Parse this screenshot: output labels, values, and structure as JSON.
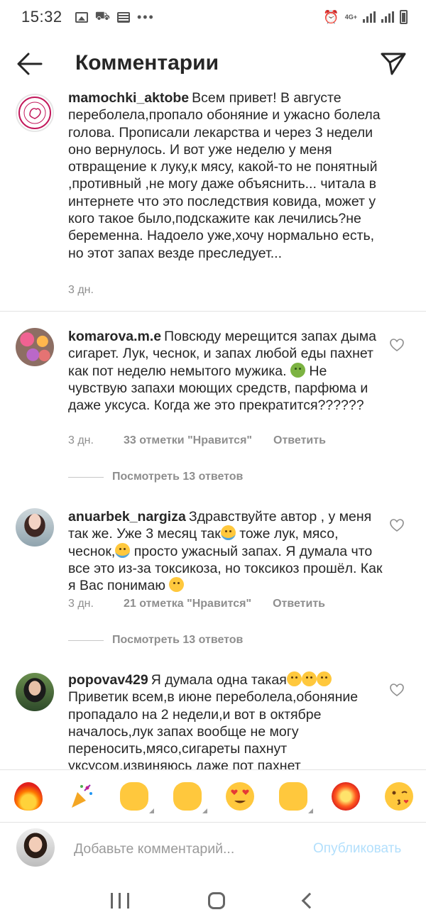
{
  "status_bar": {
    "time": "15:32",
    "network": "4G+",
    "left_icons": [
      "gallery-icon",
      "tractor-icon",
      "news-icon",
      "more-dots-icon"
    ],
    "right_icons": [
      "alarm-icon",
      "signal-icon",
      "signal-icon",
      "battery-icon"
    ]
  },
  "header": {
    "title": "Комментарии",
    "back_icon": "arrow-left-icon",
    "share_icon": "paper-plane-icon"
  },
  "comments": [
    {
      "username": "mamochki_aktobe",
      "text": "Всем привет! В августе переболела,пропало обоняние и ужасно болела голова. Прописали лекарства и через 3 недели оно вернулось. И вот уже неделю у меня отвращение к луку,к мясу, какой-то не понятный ,противный ,не могу даже объяснить... читала в интернете что это последствия ковида, может у кого такое было,подскажите как лечились?не беременна. Надоело уже,хочу нормально есть, но этот запах везде преследует...",
      "time": "3 дн."
    },
    {
      "username": "komarova.m.e",
      "text_part1": "Повсюду мерещится запах дыма сигарет. Лук, чеснок, и запах любой еды пахнет как пот неделю немытого мужика.",
      "text_part2": "Не чувствую запахи моющих средств, парфюма и даже уксуса. Когда же это прекратится??????",
      "time": "3 дн.",
      "likes": "33 отметки \"Нравится\"",
      "reply": "Ответить",
      "view_replies": "Посмотреть 13 ответов"
    },
    {
      "username": "anuarbek_nargiza",
      "text_part1": "Здравствуйте автор , у меня так же. Уже 3 месяц так",
      "text_part2": "тоже лук, мясо, чеснок,",
      "text_part3": "просто ужасный запах. Я думала что все это из-за токсикоза, но токсикоз прошёл. Как я Вас понимаю",
      "time": "3 дн.",
      "likes": "21 отметка \"Нравится\"",
      "reply": "Ответить",
      "view_replies": "Посмотреть 13 ответов"
    },
    {
      "username": "popovav429",
      "text_part1": "Я думала одна такая",
      "text_part2": "Приветик всем,в июне переболела,обоняние пропадало на 2 недели,и вот в октябре началось,лук запах  вообще не могу переносить,мясо,сигареты пахнут уксусом,извиняюсь даже пот пахнет"
    }
  ],
  "emoji_bar": [
    "fire",
    "party-popper",
    "thumbs-up",
    "ok-hand",
    "heart-eyes",
    "raising-hands",
    "collision",
    "kiss-wink"
  ],
  "add_comment": {
    "placeholder": "Добавьте комментарий...",
    "publish_label": "Опубликовать"
  },
  "colors": {
    "text": "#262626",
    "secondary": "#8e8e8e",
    "publish_disabled": "#b2dffc",
    "divider": "#e3e3e3"
  }
}
